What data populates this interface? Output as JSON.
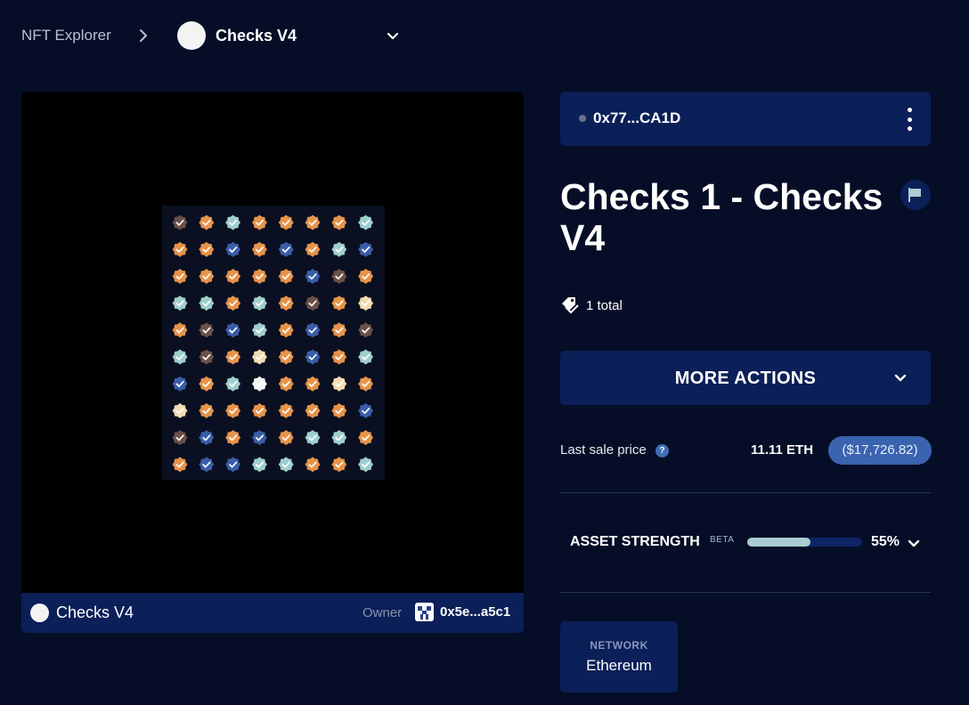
{
  "breadcrumb": {
    "root_label": "NFT Explorer",
    "collection_title": "Checks V4"
  },
  "media": {
    "check_grid": [
      [
        "brown",
        "orange",
        "teal",
        "orange",
        "orange",
        "orange",
        "orange",
        "teal"
      ],
      [
        "orange",
        "orange",
        "blue",
        "orange",
        "blue",
        "orange",
        "teal",
        "blue"
      ],
      [
        "orange",
        "orange",
        "orange",
        "orange",
        "orange",
        "blue",
        "brown",
        "orange"
      ],
      [
        "teal",
        "teal",
        "orange",
        "teal",
        "orange",
        "brown",
        "orange",
        "cream"
      ],
      [
        "orange",
        "brown",
        "blue",
        "teal",
        "orange",
        "blue",
        "orange",
        "brown"
      ],
      [
        "teal",
        "brown",
        "orange",
        "cream",
        "orange",
        "blue",
        "orange",
        "teal"
      ],
      [
        "blue",
        "orange",
        "teal",
        "white",
        "orange",
        "orange",
        "cream",
        "orange"
      ],
      [
        "cream",
        "orange",
        "orange",
        "orange",
        "orange",
        "orange",
        "orange",
        "blue"
      ],
      [
        "brown",
        "blue",
        "orange",
        "blue",
        "orange",
        "teal",
        "teal",
        "orange"
      ],
      [
        "orange",
        "blue",
        "blue",
        "teal",
        "teal",
        "orange",
        "orange",
        "teal"
      ]
    ],
    "check_colors": {
      "orange": "#e7934a",
      "teal": "#9fcfcd",
      "blue": "#3a5da8",
      "brown": "#6b5047",
      "cream": "#f2dcb2",
      "white": "#f5f5f0"
    },
    "footer_collection": "Checks V4",
    "owner_label": "Owner",
    "owner_address": "0x5e...a5c1"
  },
  "address_bar": {
    "address": "0x77...CA1D"
  },
  "nft_title": "Checks 1 - Checks V4",
  "total_text": "1 total",
  "more_actions_label": "MORE ACTIONS",
  "last_sale": {
    "label": "Last sale price",
    "help": "?",
    "eth": "11.11 ETH",
    "usd": "($17,726.82)"
  },
  "asset_strength": {
    "label": "ASSET STRENGTH",
    "badge": "BETA",
    "value_text": "55%",
    "value_fraction": 0.55
  },
  "network": {
    "label": "NETWORK",
    "value": "Ethereum"
  },
  "colors": {
    "background": "#050e26",
    "panel": "#0b1f58",
    "accent": "#3a63b0"
  }
}
